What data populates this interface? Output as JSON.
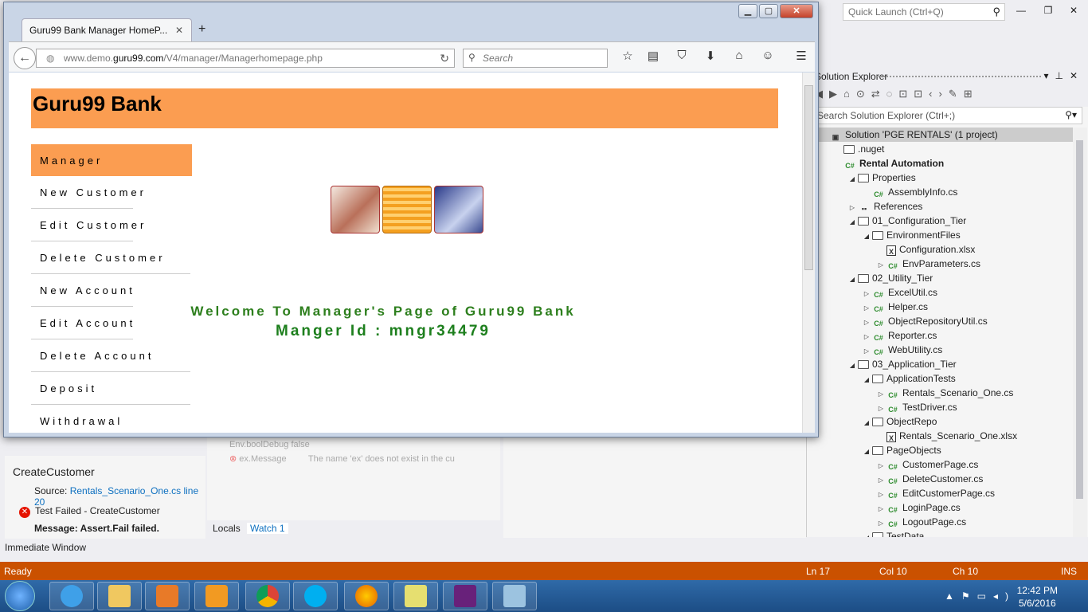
{
  "vs": {
    "quick_launch": "Quick Launch (Ctrl+Q)",
    "solution_explorer": {
      "title": "Solution Explorer",
      "search": "Search Solution Explorer (Ctrl+;)",
      "items": [
        {
          "label": "Solution 'PGE RENTALS' (1 project)",
          "icon": "solution",
          "level": 0,
          "exp": ""
        },
        {
          "label": ".nuget",
          "icon": "folder",
          "level": 1,
          "exp": ""
        },
        {
          "label": "Rental Automation",
          "icon": "csproj",
          "level": 1,
          "exp": "",
          "bold": true
        },
        {
          "label": "Properties",
          "icon": "folder",
          "level": 2,
          "exp": "◢"
        },
        {
          "label": "AssemblyInfo.cs",
          "icon": "cs",
          "level": 3,
          "exp": ""
        },
        {
          "label": "References",
          "icon": "ref",
          "level": 2,
          "exp": "▷"
        },
        {
          "label": "01_Configuration_Tier",
          "icon": "folder",
          "level": 2,
          "exp": "◢"
        },
        {
          "label": "EnvironmentFiles",
          "icon": "folder",
          "level": 3,
          "exp": "◢"
        },
        {
          "label": "Configuration.xlsx",
          "icon": "xl",
          "level": 4,
          "exp": ""
        },
        {
          "label": "EnvParameters.cs",
          "icon": "cs",
          "level": 4,
          "exp": "▷"
        },
        {
          "label": "02_Utility_Tier",
          "icon": "folder",
          "level": 2,
          "exp": "◢"
        },
        {
          "label": "ExcelUtil.cs",
          "icon": "cs",
          "level": 3,
          "exp": "▷"
        },
        {
          "label": "Helper.cs",
          "icon": "cs",
          "level": 3,
          "exp": "▷"
        },
        {
          "label": "ObjectRepositoryUtil.cs",
          "icon": "cs",
          "level": 3,
          "exp": "▷"
        },
        {
          "label": "Reporter.cs",
          "icon": "cs",
          "level": 3,
          "exp": "▷"
        },
        {
          "label": "WebUtility.cs",
          "icon": "cs",
          "level": 3,
          "exp": "▷"
        },
        {
          "label": "03_Application_Tier",
          "icon": "folder",
          "level": 2,
          "exp": "◢"
        },
        {
          "label": "ApplicationTests",
          "icon": "folder",
          "level": 3,
          "exp": "◢"
        },
        {
          "label": "Rentals_Scenario_One.cs",
          "icon": "cs",
          "level": 4,
          "exp": "▷"
        },
        {
          "label": "TestDriver.cs",
          "icon": "cs",
          "level": 4,
          "exp": "▷"
        },
        {
          "label": "ObjectRepo",
          "icon": "folder",
          "level": 3,
          "exp": "◢"
        },
        {
          "label": "Rentals_Scenario_One.xlsx",
          "icon": "xl",
          "level": 4,
          "exp": ""
        },
        {
          "label": "PageObjects",
          "icon": "folder",
          "level": 3,
          "exp": "◢"
        },
        {
          "label": "CustomerPage.cs",
          "icon": "cs",
          "level": 4,
          "exp": "▷"
        },
        {
          "label": "DeleteCustomer.cs",
          "icon": "cs",
          "level": 4,
          "exp": "▷"
        },
        {
          "label": "EditCustomerPage.cs",
          "icon": "cs",
          "level": 4,
          "exp": "▷"
        },
        {
          "label": "LoginPage.cs",
          "icon": "cs",
          "level": 4,
          "exp": "▷"
        },
        {
          "label": "LogoutPage.cs",
          "icon": "cs",
          "level": 4,
          "exp": "▷"
        },
        {
          "label": "TestData",
          "icon": "folder",
          "level": 3,
          "exp": "◢"
        }
      ]
    },
    "error": {
      "title": "CreateCustomer",
      "source_label": "Source:",
      "source_link": "Rentals_Scenario_One.cs line 20",
      "test_failed": "Test Failed - CreateCustomer",
      "message": "Message: Assert.Fail failed."
    },
    "watch": {
      "row1": "Env.boolDebug",
      "row1_val": "false",
      "row2": "ex.Message",
      "row2_val": "The name 'ex' does not exist in the cu",
      "tabs": [
        "Locals",
        "Watch 1"
      ]
    },
    "immediate": "Immediate Window",
    "status": {
      "ready": "Ready",
      "ln": "Ln 17",
      "col": "Col 10",
      "ch": "Ch 10",
      "ins": "INS"
    }
  },
  "firefox": {
    "tab_title": "Guru99 Bank Manager HomeP...",
    "url_prefix": "www.demo.",
    "url_domain": "guru99.com",
    "url_path": "/V4/manager/Managerhomepage.php",
    "search_placeholder": "Search"
  },
  "page": {
    "bank_name": "Guru99 Bank",
    "menu": [
      "Manager",
      "New Customer",
      "Edit Customer",
      "Delete Customer",
      "New Account",
      "Edit Account",
      "Delete Account",
      "Deposit",
      "Withdrawal"
    ],
    "welcome": "Welcome To Manager's Page of Guru99 Bank",
    "manager_id": "Manger Id : mngr34479"
  },
  "taskbar": {
    "time": "12:42 PM",
    "date": "5/6/2016"
  },
  "colors": {
    "accent": "#fb9d51",
    "status_bar": "#ca5100",
    "welcome_green": "#2d7f1d"
  }
}
